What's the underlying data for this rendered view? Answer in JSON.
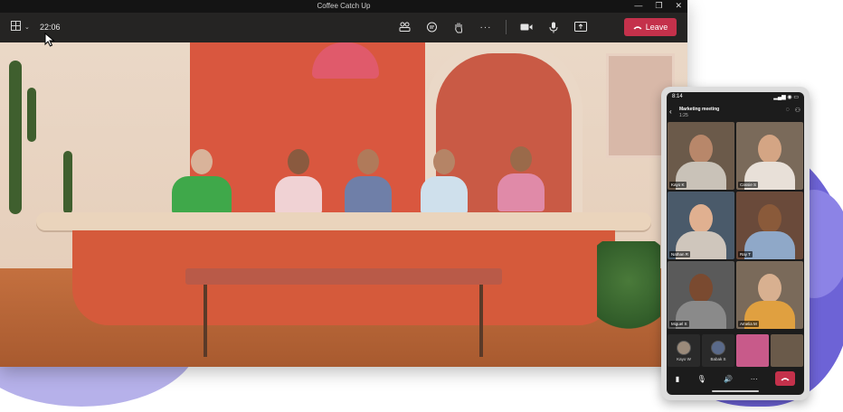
{
  "window": {
    "title": "Coffee Catch Up",
    "controls": [
      "—",
      "❐",
      "✕"
    ]
  },
  "toolbar": {
    "timer": "22:06",
    "tools": [
      {
        "name": "people-icon",
        "glyph": "⚇"
      },
      {
        "name": "chat-icon",
        "glyph": "◌"
      },
      {
        "name": "raise-hand-icon",
        "glyph": "✋"
      },
      {
        "name": "more-icon",
        "glyph": "···"
      },
      {
        "name": "camera-icon",
        "glyph": "▮"
      },
      {
        "name": "mic-icon",
        "glyph": "🎙"
      },
      {
        "name": "share-icon",
        "glyph": "⇪"
      }
    ],
    "leave_label": "Leave",
    "leave_color": "#c4314b"
  },
  "phone": {
    "time": "8:14",
    "status_icons": "▂▄▆ ◉ ▭",
    "meeting_title": "Marketing meeting",
    "meeting_sub": "1:25",
    "participants": [
      {
        "name": "Kayo K",
        "bg": "#6b5a4a",
        "skin": "#b8876a",
        "shirt": "#c9c2b8"
      },
      {
        "name": "Cassie S",
        "bg": "#7a6a5a",
        "skin": "#d4a584",
        "shirt": "#e8e0d8"
      },
      {
        "name": "Nathan R",
        "bg": "#4a5a6a",
        "skin": "#e0b090",
        "shirt": "#cfc6bc"
      },
      {
        "name": "Ray T",
        "bg": "#6a4a3a",
        "skin": "#8a5a3a",
        "shirt": "#8fa8c8"
      },
      {
        "name": "Miguel S",
        "bg": "#5a5a5a",
        "skin": "#7a4a30",
        "shirt": "#8a8a8a"
      },
      {
        "name": "Amelia M",
        "bg": "#7a6a5a",
        "skin": "#d8b090",
        "shirt": "#e0a040"
      }
    ],
    "strip": [
      "Kayo W",
      "Babak S",
      "",
      ""
    ]
  }
}
